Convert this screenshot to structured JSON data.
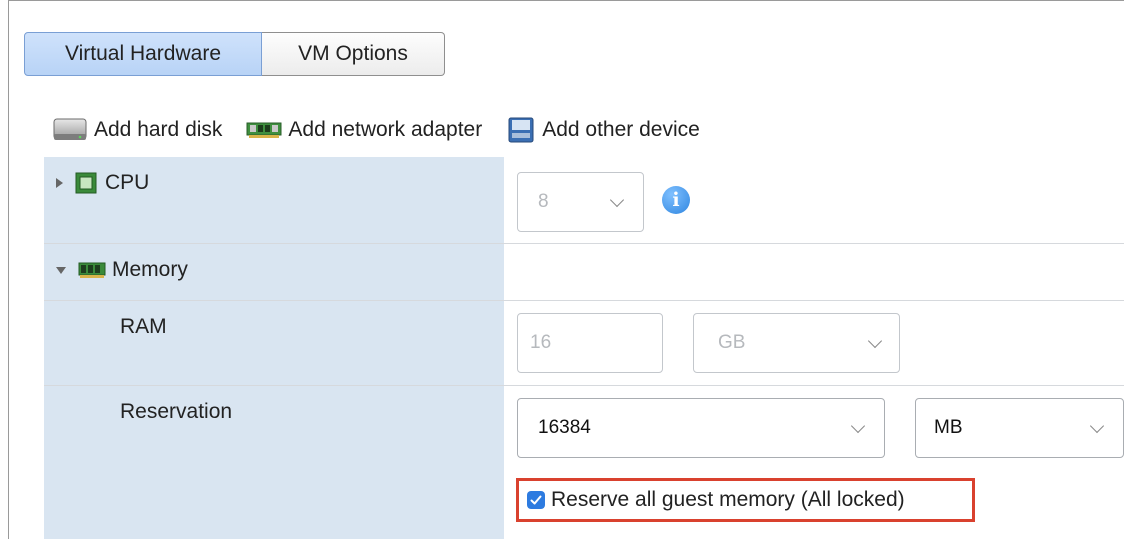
{
  "tabs": [
    {
      "label": "Virtual Hardware",
      "active": true
    },
    {
      "label": "VM Options",
      "active": false
    }
  ],
  "toolbar": {
    "add_hard_disk": "Add hard disk",
    "add_network_adapter": "Add network adapter",
    "add_other_device": "Add other device"
  },
  "cpu": {
    "label": "CPU",
    "value": "8",
    "expanded": false
  },
  "memory": {
    "label": "Memory",
    "expanded": true,
    "ram": {
      "label": "RAM",
      "value": "16",
      "unit": "GB"
    },
    "reservation": {
      "label": "Reservation",
      "value": "16384",
      "unit": "MB",
      "reserve_all_label": "Reserve all guest memory (All locked)",
      "reserve_all_checked": true
    }
  },
  "colors": {
    "highlight": "#d9412e",
    "checkbox": "#2d7be0",
    "label_column": "#d9e5f1"
  }
}
